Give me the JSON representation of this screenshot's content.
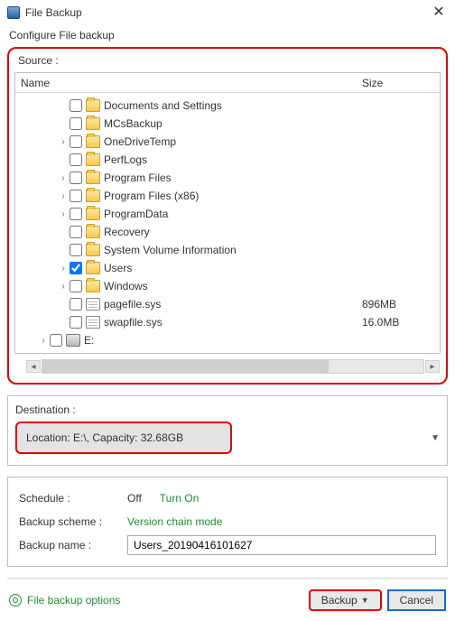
{
  "window": {
    "title": "File Backup"
  },
  "subtitle": "Configure File backup",
  "source": {
    "label": "Source :",
    "columns": {
      "name": "Name",
      "size": "Size"
    },
    "items": [
      {
        "label": "Documents and Settings",
        "type": "folder",
        "checked": false,
        "expander": ""
      },
      {
        "label": "MCsBackup",
        "type": "folder",
        "checked": false,
        "expander": ""
      },
      {
        "label": "OneDriveTemp",
        "type": "folder",
        "checked": false,
        "expander": "›"
      },
      {
        "label": "PerfLogs",
        "type": "folder",
        "checked": false,
        "expander": ""
      },
      {
        "label": "Program Files",
        "type": "folder",
        "checked": false,
        "expander": "›"
      },
      {
        "label": "Program Files (x86)",
        "type": "folder",
        "checked": false,
        "expander": "›"
      },
      {
        "label": "ProgramData",
        "type": "folder",
        "checked": false,
        "expander": "›"
      },
      {
        "label": "Recovery",
        "type": "folder",
        "checked": false,
        "expander": ""
      },
      {
        "label": "System Volume Information",
        "type": "folder",
        "checked": false,
        "expander": ""
      },
      {
        "label": "Users",
        "type": "folder",
        "checked": true,
        "expander": "›"
      },
      {
        "label": "Windows",
        "type": "folder",
        "checked": false,
        "expander": "›"
      },
      {
        "label": "pagefile.sys",
        "type": "file",
        "checked": false,
        "expander": "",
        "size": "896MB"
      },
      {
        "label": "swapfile.sys",
        "type": "file",
        "checked": false,
        "expander": "",
        "size": "16.0MB"
      },
      {
        "label": "E:",
        "type": "drive",
        "checked": false,
        "expander": "›"
      }
    ]
  },
  "destination": {
    "label": "Destination :",
    "value": "Location: E:\\, Capacity: 32.68GB"
  },
  "schedule": {
    "key": "Schedule :",
    "status": "Off",
    "action": "Turn On"
  },
  "scheme": {
    "key": "Backup scheme :",
    "value": "Version chain mode"
  },
  "backup_name": {
    "key": "Backup name :",
    "value": "Users_20190416101627"
  },
  "options_label": "File backup options",
  "buttons": {
    "backup": "Backup",
    "cancel": "Cancel"
  }
}
